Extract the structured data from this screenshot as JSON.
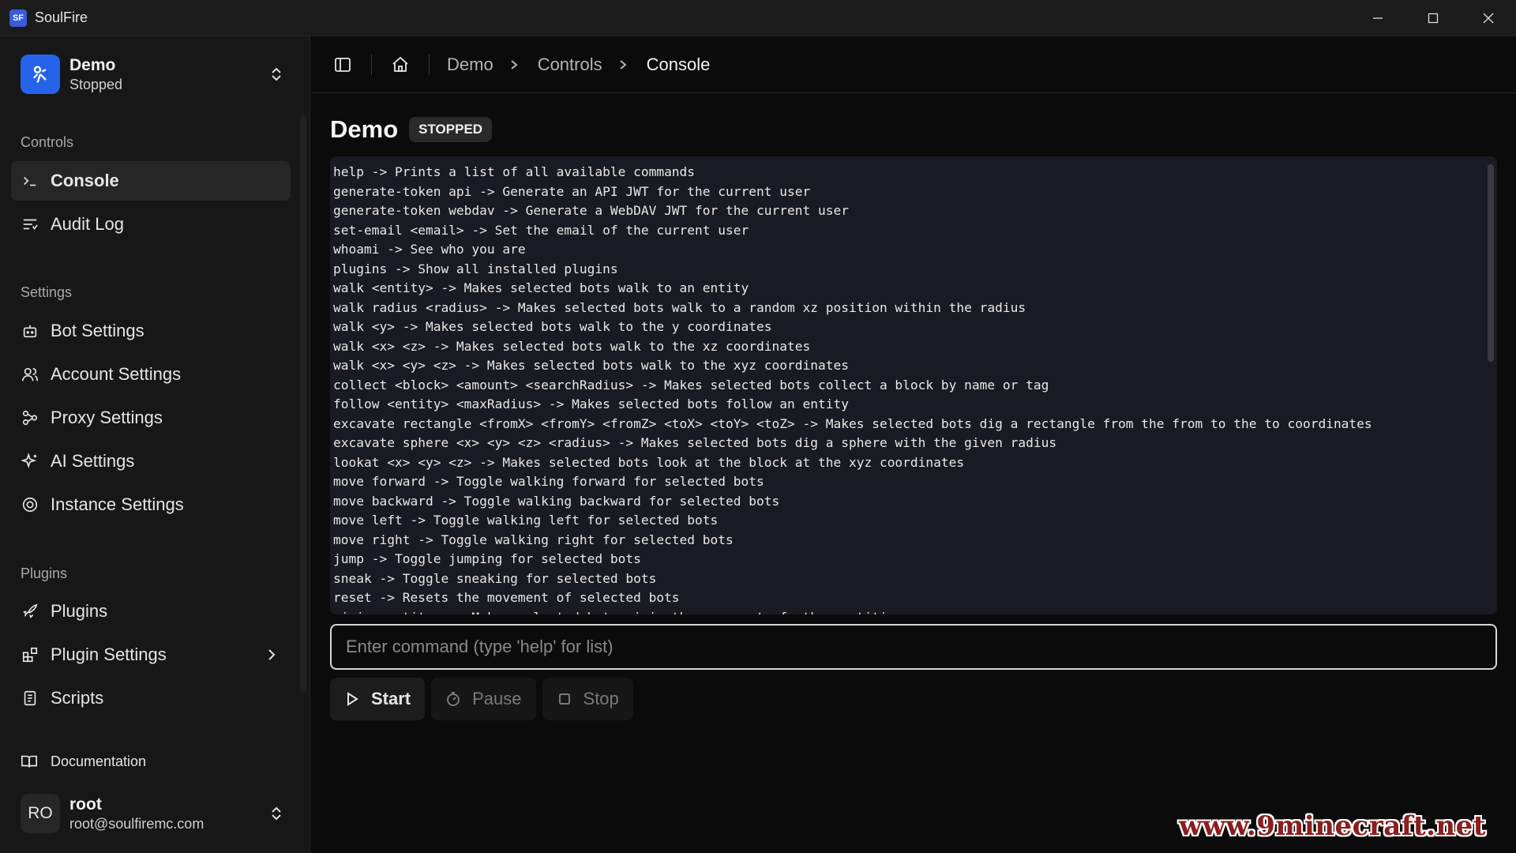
{
  "window": {
    "logo_text": "SF",
    "title": "SoulFire"
  },
  "instance": {
    "name": "Demo",
    "status": "Stopped"
  },
  "sidebar": {
    "groups": {
      "controls": "Controls",
      "settings": "Settings",
      "plugins": "Plugins"
    },
    "items": {
      "console": "Console",
      "audit_log": "Audit Log",
      "bot_settings": "Bot Settings",
      "account_settings": "Account Settings",
      "proxy_settings": "Proxy Settings",
      "ai_settings": "AI Settings",
      "instance_settings": "Instance Settings",
      "plugins": "Plugins",
      "plugin_settings": "Plugin Settings",
      "scripts": "Scripts"
    },
    "documentation": "Documentation",
    "user": {
      "initials": "RO",
      "name": "root",
      "email": "root@soulfiremc.com"
    }
  },
  "breadcrumb": [
    "Demo",
    "Controls",
    "Console"
  ],
  "page": {
    "title": "Demo",
    "status_badge": "STOPPED"
  },
  "console": {
    "lines": [
      "help -> Prints a list of all available commands",
      "generate-token api -> Generate an API JWT for the current user",
      "generate-token webdav -> Generate a WebDAV JWT for the current user",
      "set-email <email> -> Set the email of the current user",
      "whoami -> See who you are",
      "plugins -> Show all installed plugins",
      "walk <entity> -> Makes selected bots walk to an entity",
      "walk radius <radius> -> Makes selected bots walk to a random xz position within the radius",
      "walk <y> -> Makes selected bots walk to the y coordinates",
      "walk <x> <z> -> Makes selected bots walk to the xz coordinates",
      "walk <x> <y> <z> -> Makes selected bots walk to the xyz coordinates",
      "collect <block> <amount> <searchRadius> -> Makes selected bots collect a block by name or tag",
      "follow <entity> <maxRadius> -> Makes selected bots follow an entity",
      "excavate rectangle <fromX> <fromY> <fromZ> <toX> <toY> <toZ> -> Makes selected bots dig a rectangle from the from to the to coordinates",
      "excavate sphere <x> <y> <z> <radius> -> Makes selected bots dig a sphere with the given radius",
      "lookat <x> <y> <z> -> Makes selected bots look at the block at the xyz coordinates",
      "move forward -> Toggle walking forward for selected bots",
      "move backward -> Toggle walking backward for selected bots",
      "move left -> Toggle walking left for selected bots",
      "move right -> Toggle walking right for selected bots",
      "jump -> Toggle jumping for selected bots",
      "sneak -> Toggle sneaking for selected bots",
      "reset -> Resets the movement of selected bots",
      "mimic <entity> -> Makes selected bots mimic the movement of other entities"
    ]
  },
  "command_input": {
    "placeholder": "Enter command (type 'help' for list)",
    "value": ""
  },
  "controls": {
    "start": "Start",
    "pause": "Pause",
    "stop": "Stop"
  },
  "watermark": "www.9minecraft.net",
  "colors": {
    "accent": "#2563eb",
    "background": "#0b0b0b",
    "sidebar": "#171717",
    "console_bg": "#1a1a24"
  }
}
